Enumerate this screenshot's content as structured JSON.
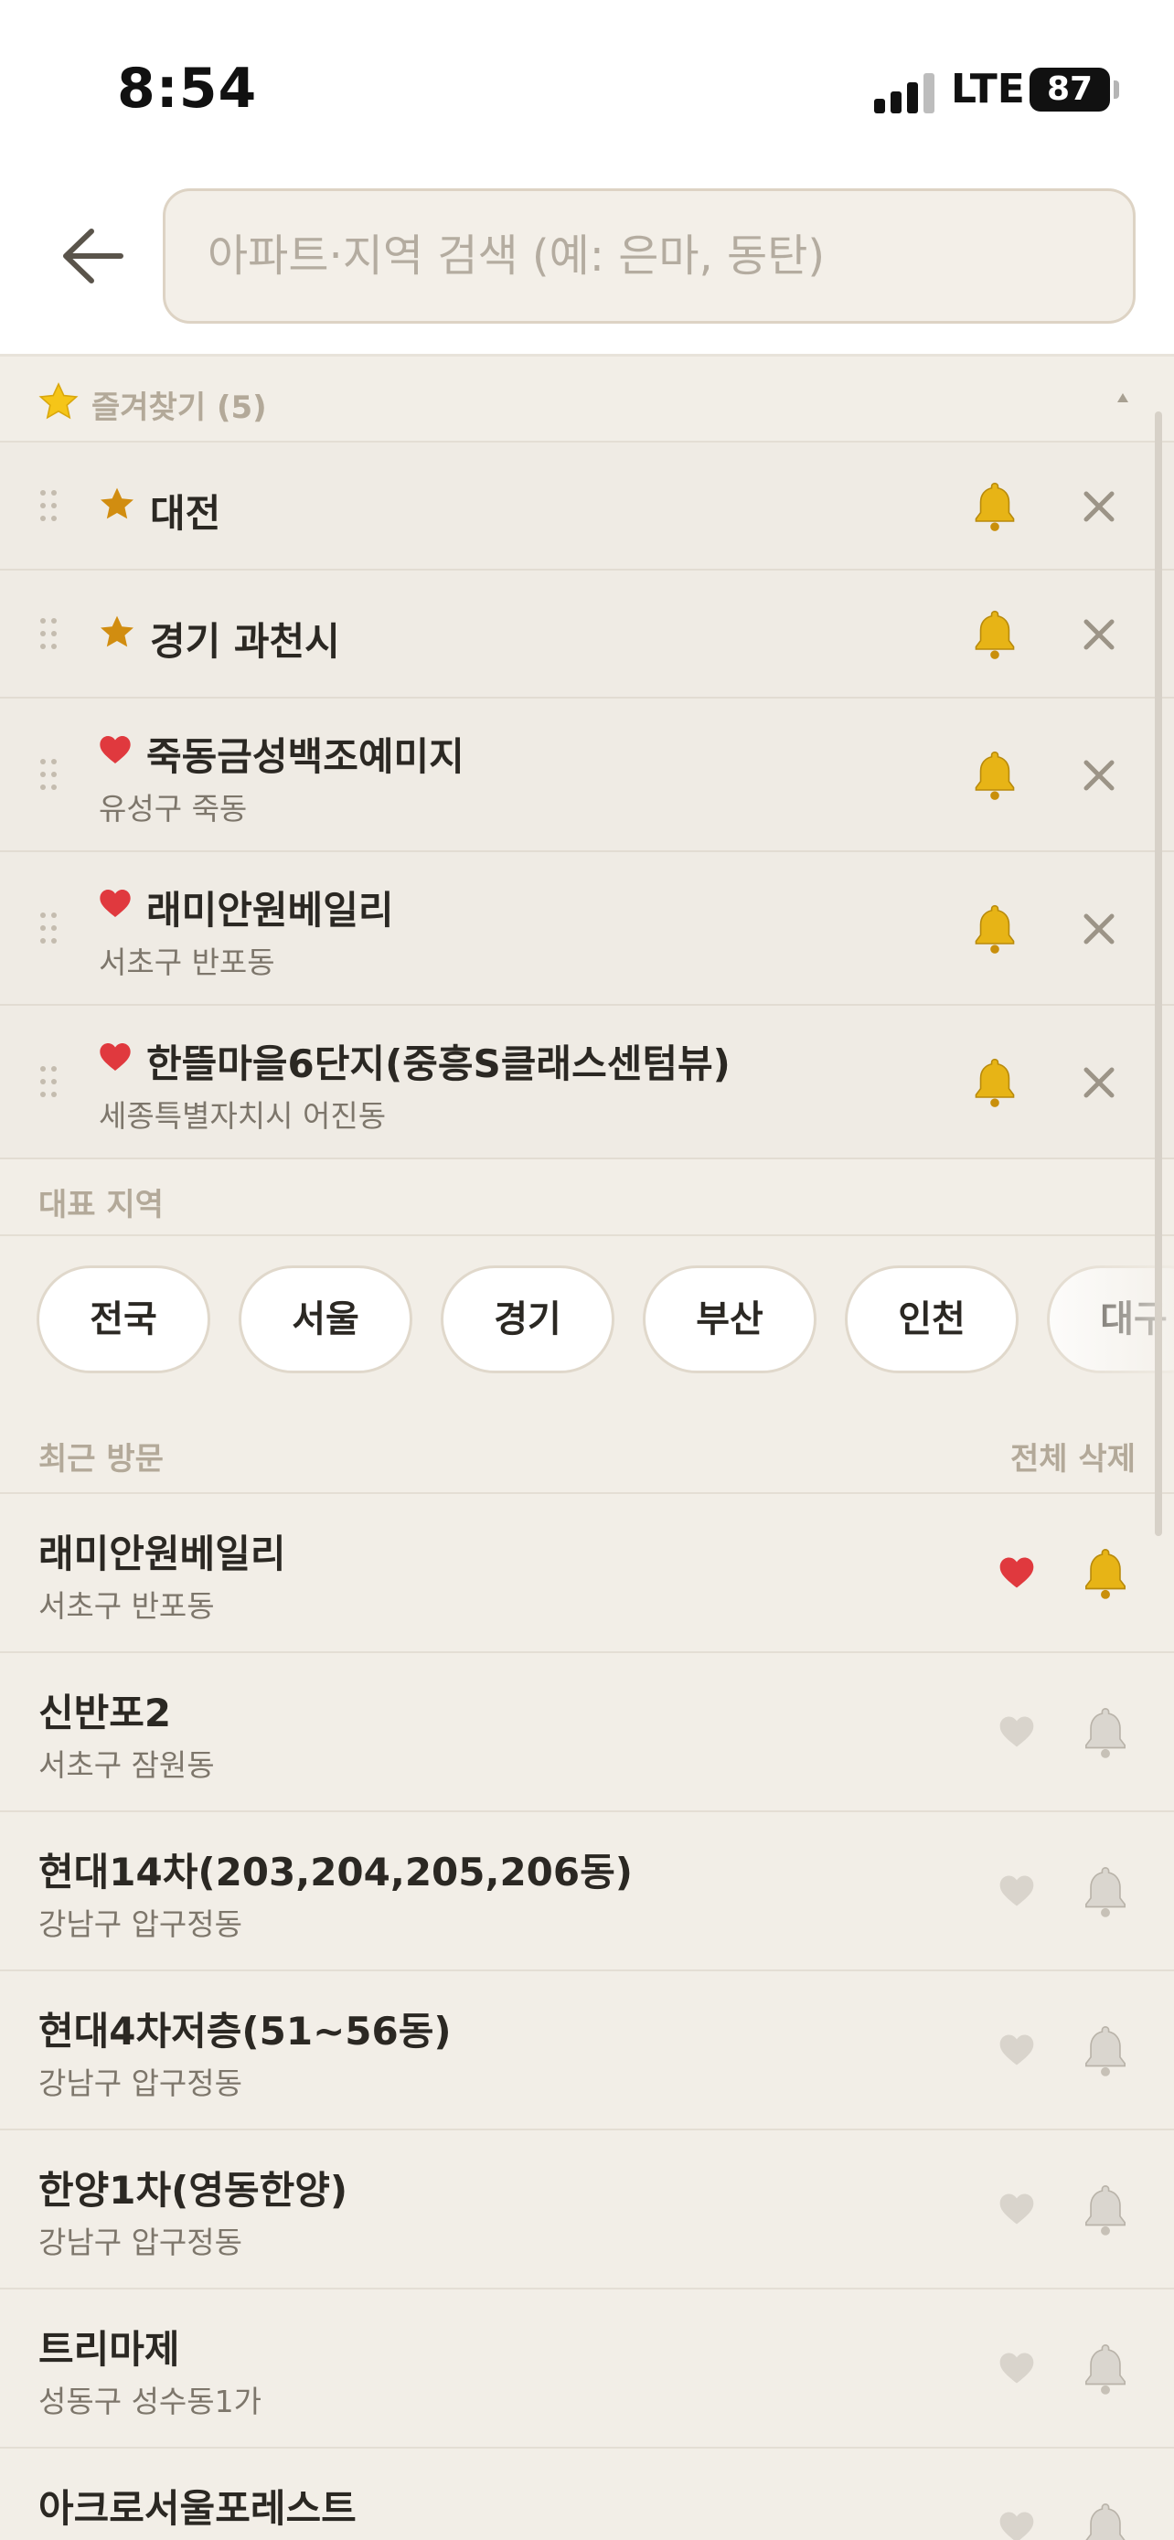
{
  "status": {
    "time": "8:54",
    "network": "LTE",
    "battery": "87"
  },
  "search": {
    "placeholder": "아파트·지역 검색 (예: 은마, 동탄)"
  },
  "favorites": {
    "title": "즐겨찾기 (5)",
    "items": [
      {
        "type": "region",
        "title": "대전",
        "subtitle": ""
      },
      {
        "type": "region",
        "title": "경기 과천시",
        "subtitle": ""
      },
      {
        "type": "apartment",
        "title": "죽동금성백조예미지",
        "subtitle": "유성구 죽동"
      },
      {
        "type": "apartment",
        "title": "래미안원베일리",
        "subtitle": "서초구 반포동"
      },
      {
        "type": "apartment",
        "title": "한뜰마을6단지(중흥S클래스센텀뷰)",
        "subtitle": "세종특별자치시 어진동"
      }
    ]
  },
  "regions": {
    "title": "대표 지역",
    "chips": [
      "전국",
      "서울",
      "경기",
      "부산",
      "인천",
      "대구"
    ]
  },
  "recent": {
    "title": "최근 방문",
    "clear_label": "전체 삭제",
    "items": [
      {
        "title": "래미안원베일리",
        "subtitle": "서초구 반포동",
        "favorited": true,
        "alert": true
      },
      {
        "title": "신반포2",
        "subtitle": "서초구 잠원동",
        "favorited": false,
        "alert": false
      },
      {
        "title": "현대14차(203,204,205,206동)",
        "subtitle": "강남구 압구정동",
        "favorited": false,
        "alert": false
      },
      {
        "title": "현대4차저층(51~56동)",
        "subtitle": "강남구 압구정동",
        "favorited": false,
        "alert": false
      },
      {
        "title": "한양1차(영동한양)",
        "subtitle": "강남구 압구정동",
        "favorited": false,
        "alert": false
      },
      {
        "title": "트리마제",
        "subtitle": "성동구 성수동1가",
        "favorited": false,
        "alert": false
      },
      {
        "title": "아크로서울포레스트",
        "subtitle": "",
        "favorited": false,
        "alert": false
      }
    ]
  },
  "colors": {
    "background": "#f2eee7",
    "accent_gold": "#d4a017",
    "heart_red": "#e0393e",
    "muted": "#b3a999"
  }
}
